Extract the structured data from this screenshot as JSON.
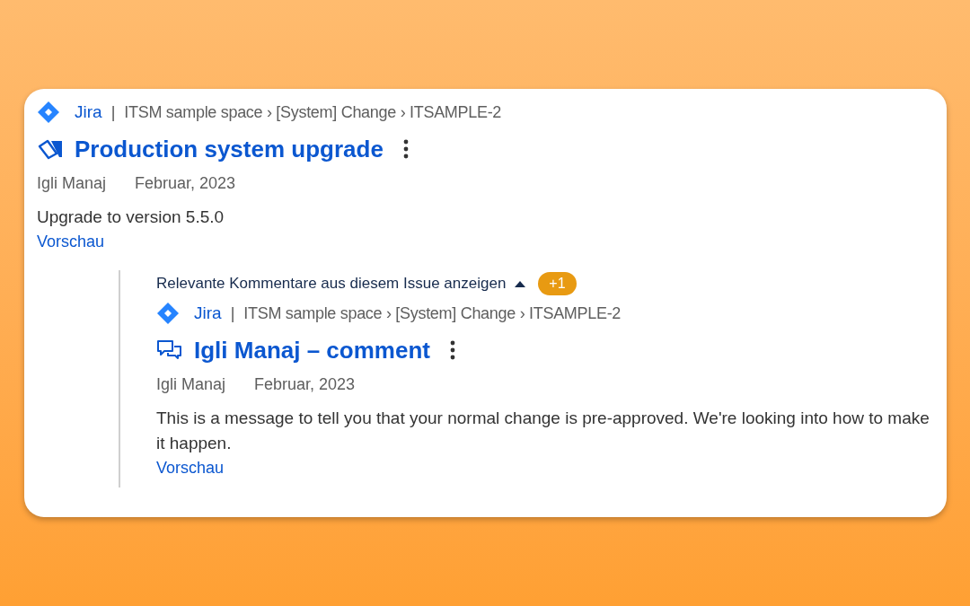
{
  "result": {
    "source": "Jira",
    "separator": "|",
    "breadcrumb": "ITSM sample space › [System] Change › ITSAMPLE-2",
    "title": "Production system upgrade",
    "author": "Igli Manaj",
    "date": "Februar, 2023",
    "excerpt": "Upgrade to version 5.5.0",
    "preview_link": "Vorschau"
  },
  "comments_toggle": {
    "label": "Relevante Kommentare aus diesem Issue anzeigen",
    "expanded": true,
    "badge": "+1"
  },
  "comment": {
    "source": "Jira",
    "separator": "|",
    "breadcrumb": "ITSM sample space › [System] Change › ITSAMPLE-2",
    "title": "Igli Manaj – comment",
    "author": "Igli Manaj",
    "date": "Februar, 2023",
    "excerpt": "This is a message to tell you that your normal change is pre-approved. We're looking into how to make it happen.",
    "preview_link": "Vorschau"
  }
}
